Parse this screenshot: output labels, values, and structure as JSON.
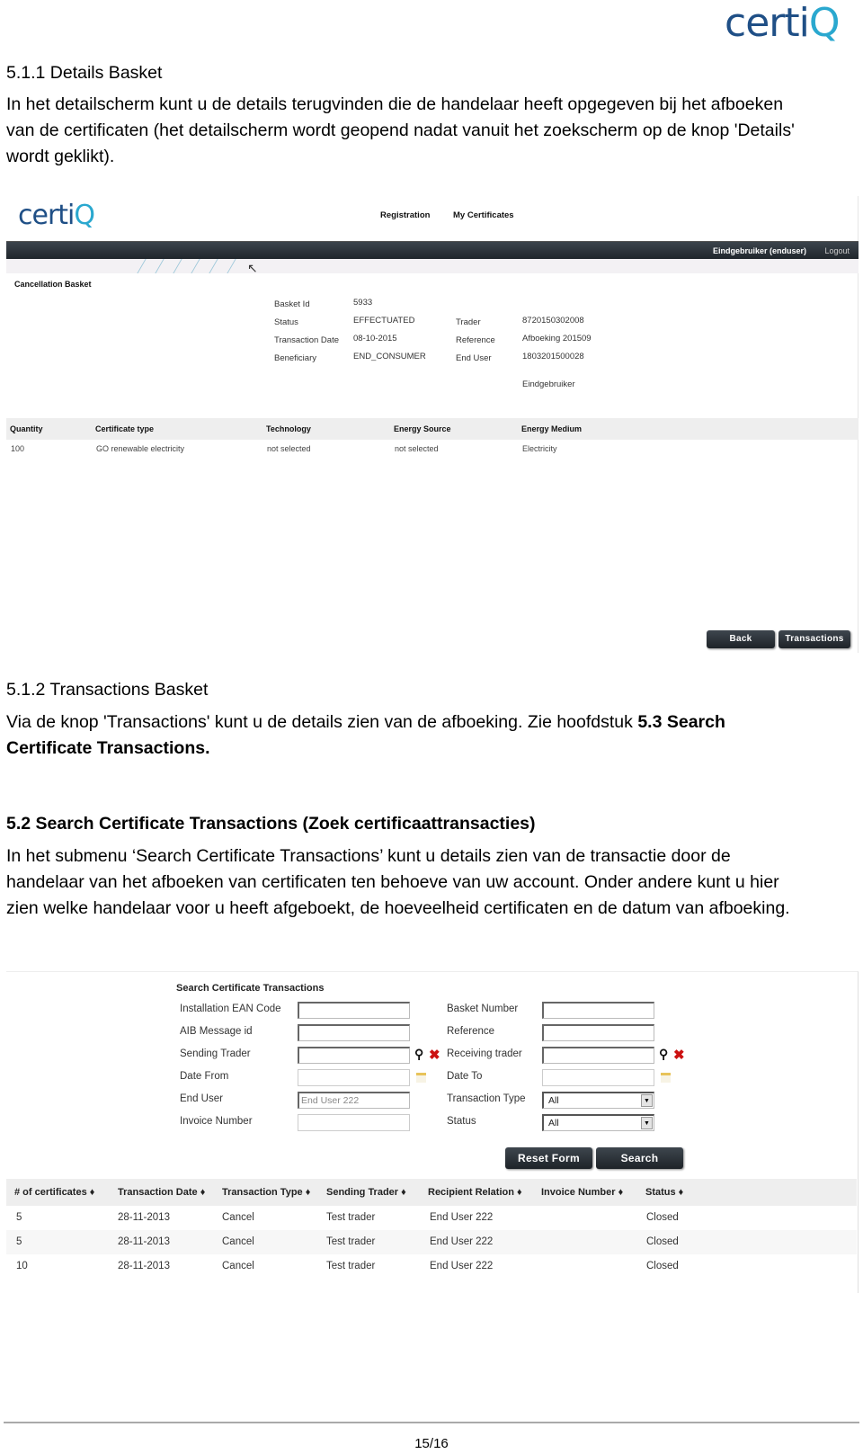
{
  "document": {
    "logo": {
      "text_main": "certi",
      "text_accent": "Q"
    },
    "section_511": {
      "heading": "5.1.1 Details Basket",
      "lines": [
        "In het detailscherm kunt u de details terugvinden die de handelaar heeft opgegeven bij het afboeken",
        "van de certificaten (het detailscherm wordt geopend nadat vanuit het zoekscherm op de knop 'Details'",
        "wordt geklikt)."
      ]
    },
    "section_512": {
      "heading": "5.1.2 Transactions Basket",
      "line1_plain": "Via de knop 'Transactions' kunt u de details zien van de afboeking. Zie hoofdstuk ",
      "line1_bold": "5.3 Search",
      "line2_bold": "Certificate Transactions."
    },
    "section_52": {
      "heading": "5.2 Search Certificate Transactions (Zoek certificaattransacties)",
      "lines": [
        "In het submenu ‘Search Certificate Transactions’ kunt u details zien van de transactie door de",
        "handelaar van het afboeken van certificaten ten behoeve van uw account. Onder andere kunt u hier",
        "zien welke handelaar voor u heeft afgeboekt, de hoeveelheid certificaten en de datum van afboeking."
      ]
    },
    "page_number": "15/16"
  },
  "screenshot1": {
    "logo": {
      "text_main": "certi",
      "text_accent": "Q"
    },
    "nav": {
      "registration": "Registration",
      "my_certificates": "My Certificates"
    },
    "navbar": {
      "user": "Eindgebruiker (enduser)",
      "logout": "Logout"
    },
    "section_title": "Cancellation Basket",
    "details": {
      "basket_id_label": "Basket Id",
      "basket_id": "5933",
      "status_label": "Status",
      "status": "EFFECTUATED",
      "transaction_date_label": "Transaction Date",
      "transaction_date": "08-10-2015",
      "beneficiary_label": "Beneficiary",
      "beneficiary": "END_CONSUMER",
      "trader_label": "Trader",
      "trader": "8720150302008",
      "reference_label": "Reference",
      "reference": "Afboeking 201509",
      "end_user_label": "End User",
      "end_user": "1803201500028",
      "end_user_name": "Eindgebruiker"
    },
    "grid": {
      "headers": [
        "Quantity",
        "Certificate type",
        "Technology",
        "Energy Source",
        "Energy Medium"
      ],
      "rows": [
        [
          "100",
          "GO renewable electricity",
          "not selected",
          "not selected",
          "Electricity"
        ]
      ]
    },
    "buttons": {
      "back": "Back",
      "transactions": "Transactions"
    }
  },
  "screenshot2": {
    "form_title": "Search Certificate Transactions",
    "fields": {
      "installation_ean_label": "Installation EAN Code",
      "installation_ean_value": "",
      "aib_message_label": "AIB Message id",
      "aib_message_value": "",
      "sending_trader_label": "Sending Trader",
      "sending_trader_value": "",
      "date_from_label": "Date From",
      "date_from_value": "",
      "end_user_label": "End User",
      "end_user_value": "End User 222",
      "invoice_number_label": "Invoice Number",
      "invoice_number_value": "",
      "basket_number_label": "Basket Number",
      "basket_number_value": "",
      "reference_label": "Reference",
      "reference_value": "",
      "receiving_trader_label": "Receiving trader",
      "receiving_trader_value": "",
      "date_to_label": "Date To",
      "date_to_value": "",
      "transaction_type_label": "Transaction Type",
      "transaction_type_value": "All",
      "status_label": "Status",
      "status_value": "All"
    },
    "icons": {
      "search": "🔍",
      "clear": "✖",
      "select_arrow": "▼",
      "sort": "↕"
    },
    "buttons": {
      "reset": "Reset Form",
      "search": "Search"
    },
    "table": {
      "headers": [
        "# of certificates ♦",
        "Transaction Date ♦",
        "Transaction Type ♦",
        "Sending Trader ♦",
        "Recipient Relation ♦",
        "Invoice Number ♦",
        "Status ♦"
      ],
      "rows": [
        [
          "5",
          "28-11-2013",
          "Cancel",
          "Test trader",
          "End User 222",
          "",
          "Closed"
        ],
        [
          "5",
          "28-11-2013",
          "Cancel",
          "Test trader",
          "End User 222",
          "",
          "Closed"
        ],
        [
          "10",
          "28-11-2013",
          "Cancel",
          "Test trader",
          "End User 222",
          "",
          "Closed"
        ]
      ]
    }
  }
}
